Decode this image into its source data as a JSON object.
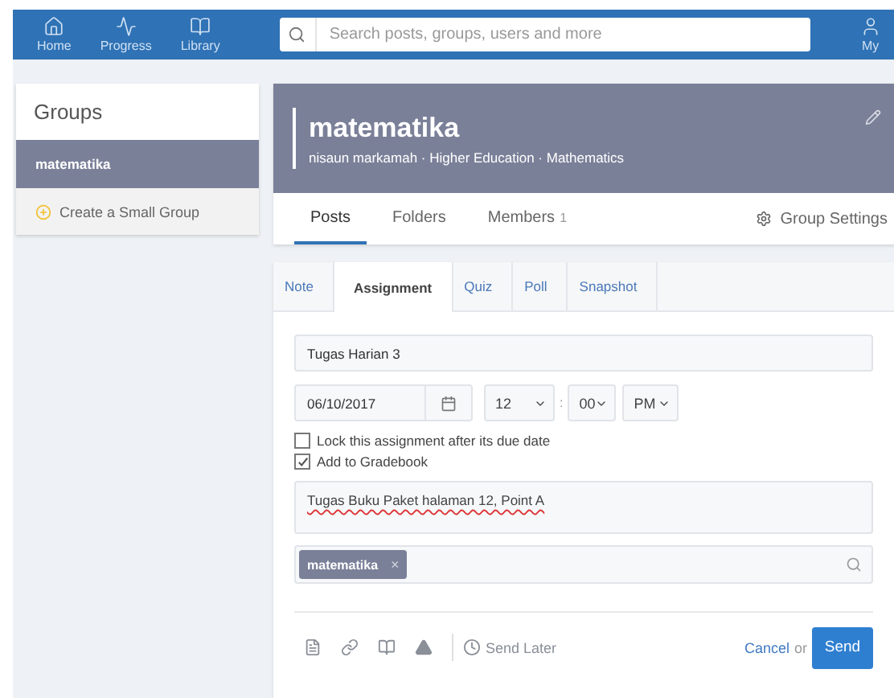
{
  "nav": [
    {
      "label": "Home",
      "kind": "home"
    },
    {
      "label": "Progress",
      "kind": "progress"
    },
    {
      "label": "Library",
      "kind": "library"
    }
  ],
  "account": {
    "label": "My"
  },
  "search": {
    "placeholder": "Search posts, groups, users and more"
  },
  "sidebar": {
    "title": "Groups",
    "items": [
      {
        "label": "matematika",
        "selected": true
      }
    ],
    "create": "Create a Small Group"
  },
  "group": {
    "name": "matematika",
    "meta": "nisaun markamah · Higher Education · Mathematics"
  },
  "group_tabs": [
    {
      "label": "Posts",
      "selected": true
    },
    {
      "label": "Folders",
      "selected": false
    },
    {
      "label": "Members",
      "count": "1",
      "selected": false
    }
  ],
  "group_settings": "Group Settings",
  "composer_tabs": [
    {
      "label": "Note",
      "selected": false
    },
    {
      "label": "Assignment",
      "selected": true
    },
    {
      "label": "Quiz",
      "selected": false
    },
    {
      "label": "Poll",
      "selected": false
    },
    {
      "label": "Snapshot",
      "selected": false
    }
  ],
  "assignment": {
    "title": "Tugas Harian 3",
    "date": "06/10/2017",
    "hour": "12",
    "separator": ":",
    "minute": "00",
    "ampm": "PM",
    "options": [
      {
        "label": "Lock this assignment after its due date",
        "checked": false
      },
      {
        "label": "Add to Gradebook",
        "checked": true
      }
    ],
    "description": "Tugas Buku Paket halaman 12, Point A",
    "recipients": [
      {
        "label": "matematika",
        "remove": "×"
      }
    ]
  },
  "footer": {
    "send_later": "Send Later",
    "cancel": "Cancel",
    "or": "or",
    "send": "Send"
  }
}
